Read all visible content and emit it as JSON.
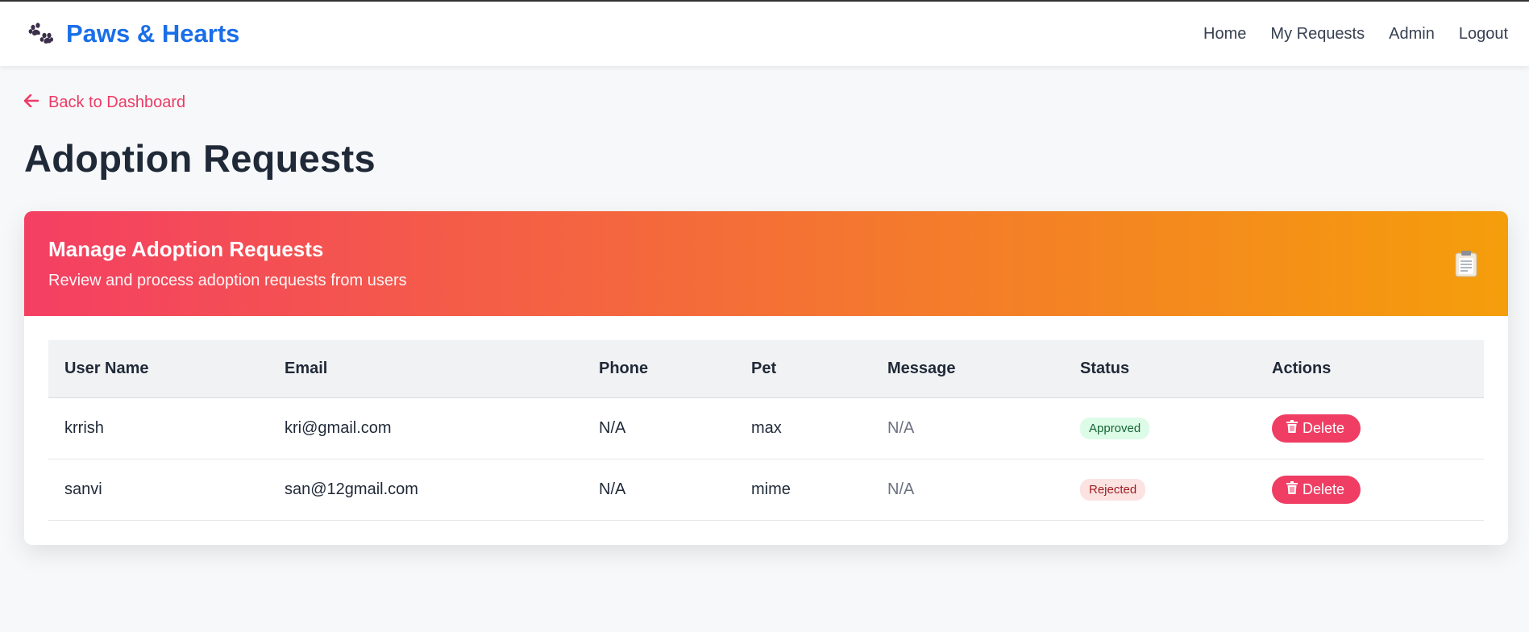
{
  "brand": {
    "name": "Paws & Hearts",
    "icon": "paw-icon",
    "color": "#1a6ee8"
  },
  "nav": {
    "links": [
      "Home",
      "My Requests",
      "Admin",
      "Logout"
    ]
  },
  "back_link": {
    "label": "Back to Dashboard",
    "icon": "arrow-left-icon"
  },
  "page_title": "Adoption Requests",
  "card": {
    "title": "Manage Adoption Requests",
    "subtitle": "Review and process adoption requests from users",
    "icon": "clipboard-icon",
    "gradient": [
      "#f43f63",
      "#f59e0b"
    ]
  },
  "table": {
    "columns": [
      "User Name",
      "Email",
      "Phone",
      "Pet",
      "Message",
      "Status",
      "Actions"
    ],
    "rows": [
      {
        "user": "krrish",
        "email": "kri@gmail.com",
        "phone": "N/A",
        "pet": "max",
        "message": "N/A",
        "status": "Approved",
        "action": "Delete"
      },
      {
        "user": "sanvi",
        "email": "san@12gmail.com",
        "phone": "N/A",
        "pet": "mime",
        "message": "N/A",
        "status": "Rejected",
        "action": "Delete"
      }
    ]
  },
  "colors": {
    "accent": "#ef3d63",
    "approved": "#166534",
    "rejected": "#9b1c1c"
  }
}
